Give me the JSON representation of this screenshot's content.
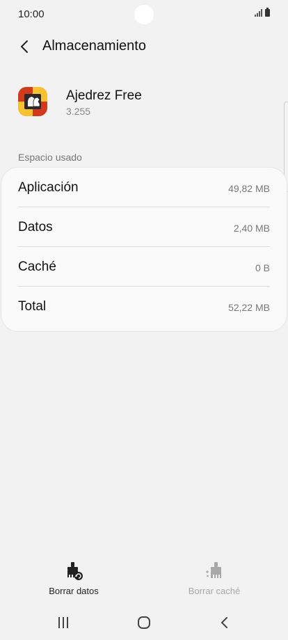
{
  "status_bar": {
    "time": "10:00",
    "icons": [
      "signal-icon",
      "battery-icon"
    ]
  },
  "header": {
    "back_icon": "chevron-left-icon",
    "title": "Almacenamiento"
  },
  "app": {
    "name": "Ajedrez Free",
    "version": "3.255",
    "icon": "chess-app-icon"
  },
  "section_label": "Espacio usado",
  "storage": {
    "rows": [
      {
        "label": "Aplicación",
        "value": "49,82 MB"
      },
      {
        "label": "Datos",
        "value": "2,40 MB"
      },
      {
        "label": "Caché",
        "value": "0 B"
      },
      {
        "label": "Total",
        "value": "52,22 MB"
      }
    ]
  },
  "actions": {
    "clear_data": {
      "label": "Borrar datos",
      "icon": "broom-clear-data-icon",
      "enabled": true
    },
    "clear_cache": {
      "label": "Borrar caché",
      "icon": "broom-clear-cache-icon",
      "enabled": false
    }
  },
  "nav_bar": {
    "icons": [
      "recent-apps-icon",
      "home-icon",
      "back-icon"
    ]
  },
  "colors": {
    "background": "#f2f2f2",
    "card": "#fafafa",
    "disabled_text": "#a8a8a8",
    "icon_orange": "#f0a020",
    "icon_red": "#d23a1e"
  }
}
